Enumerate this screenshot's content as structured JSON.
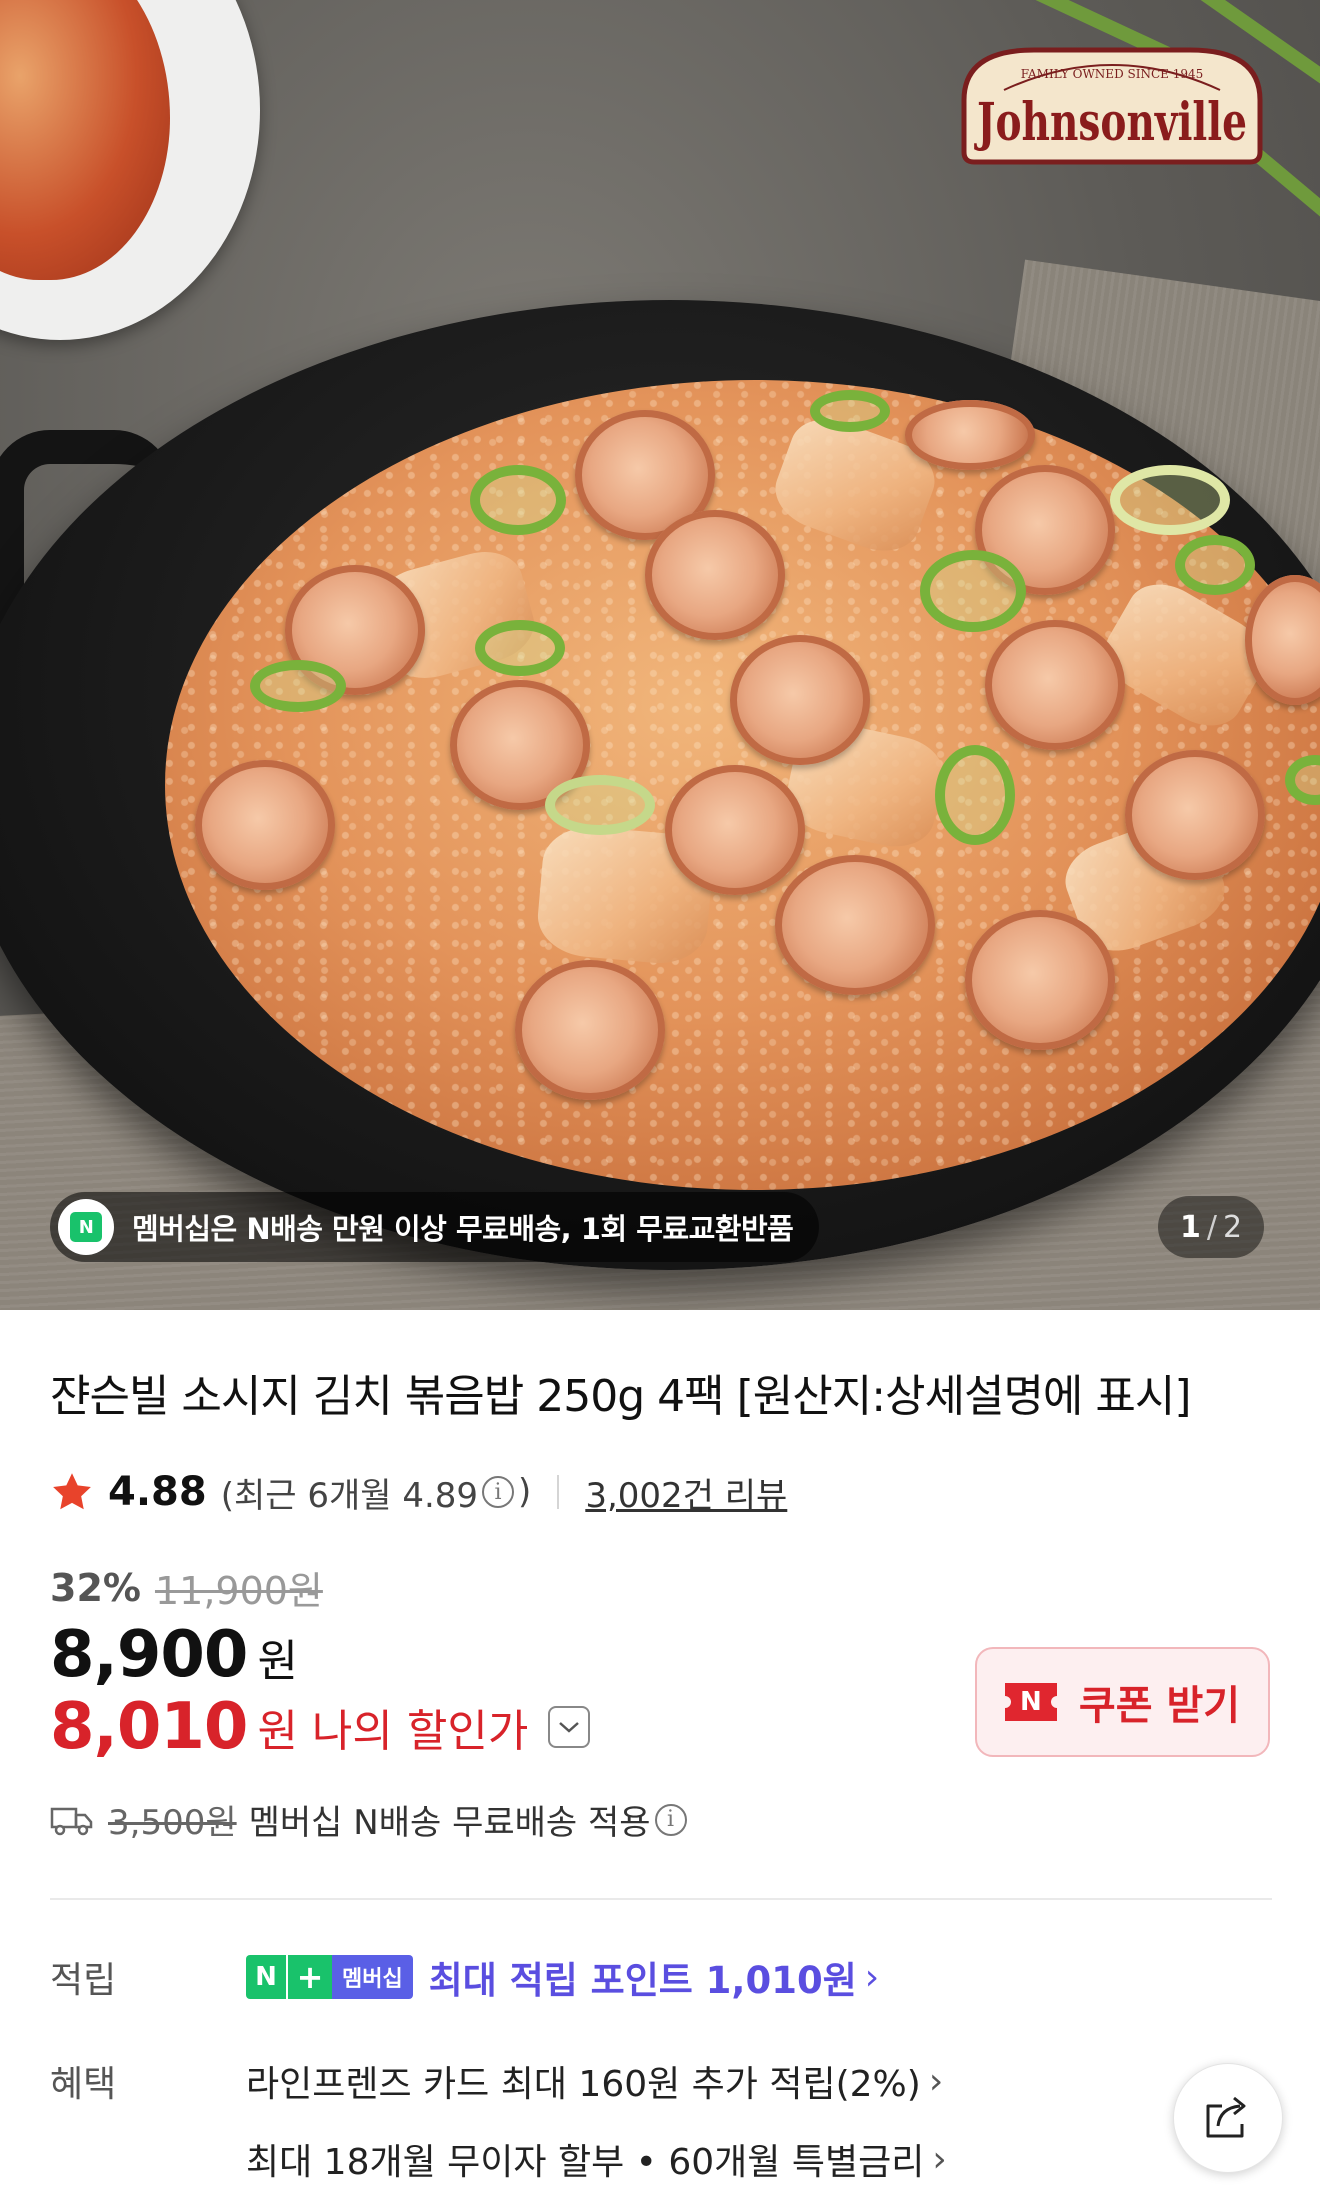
{
  "hero": {
    "brand_logo_text": "Johnsonville",
    "brand_logo_subtext": "FAMILY OWNED SINCE 1945",
    "membership_banner": "멤버십은 N배송 만원 이상 무료배송, 1회 무료교환반품",
    "membership_icon_letter": "N",
    "image_index": "1",
    "image_total": "2",
    "image_index_separator": "/"
  },
  "product": {
    "title": "쟌슨빌 소시지 김치 볶음밥 250g 4팩 [원산지:상세설명에 표시]",
    "rating": "4.88",
    "rating_recent": "(최근 6개월 4.89",
    "rating_recent_close": ")",
    "info_glyph": "i",
    "review_count": "3,002건 리뷰"
  },
  "price": {
    "discount_rate": "32%",
    "original_price": "11,900원",
    "sale_price": "8,900",
    "currency": "원",
    "my_price": "8,010",
    "my_price_currency": "원",
    "my_price_label": "나의 할인가"
  },
  "coupon": {
    "icon_letter": "N",
    "label": "쿠폰 받기"
  },
  "shipping": {
    "original_fee": "3,500원",
    "text": "멤버십 N배송 무료배송 적용"
  },
  "points": {
    "label": "적립",
    "badge_n": "N",
    "badge_plus": "+",
    "badge_membership": "멤버십",
    "text": "최대 적립 포인트 1,010원"
  },
  "benefits": {
    "label": "혜택",
    "lines": [
      "라인프렌즈 카드 최대 160원 추가 적립(2%)",
      "최대 18개월 무이자 할부 • 60개월 특별금리"
    ]
  },
  "colors": {
    "accent_red": "#d8232a",
    "naver_green": "#19c26b",
    "membership_purple": "#5a4ee0",
    "coupon_bg": "#fdeff0"
  }
}
